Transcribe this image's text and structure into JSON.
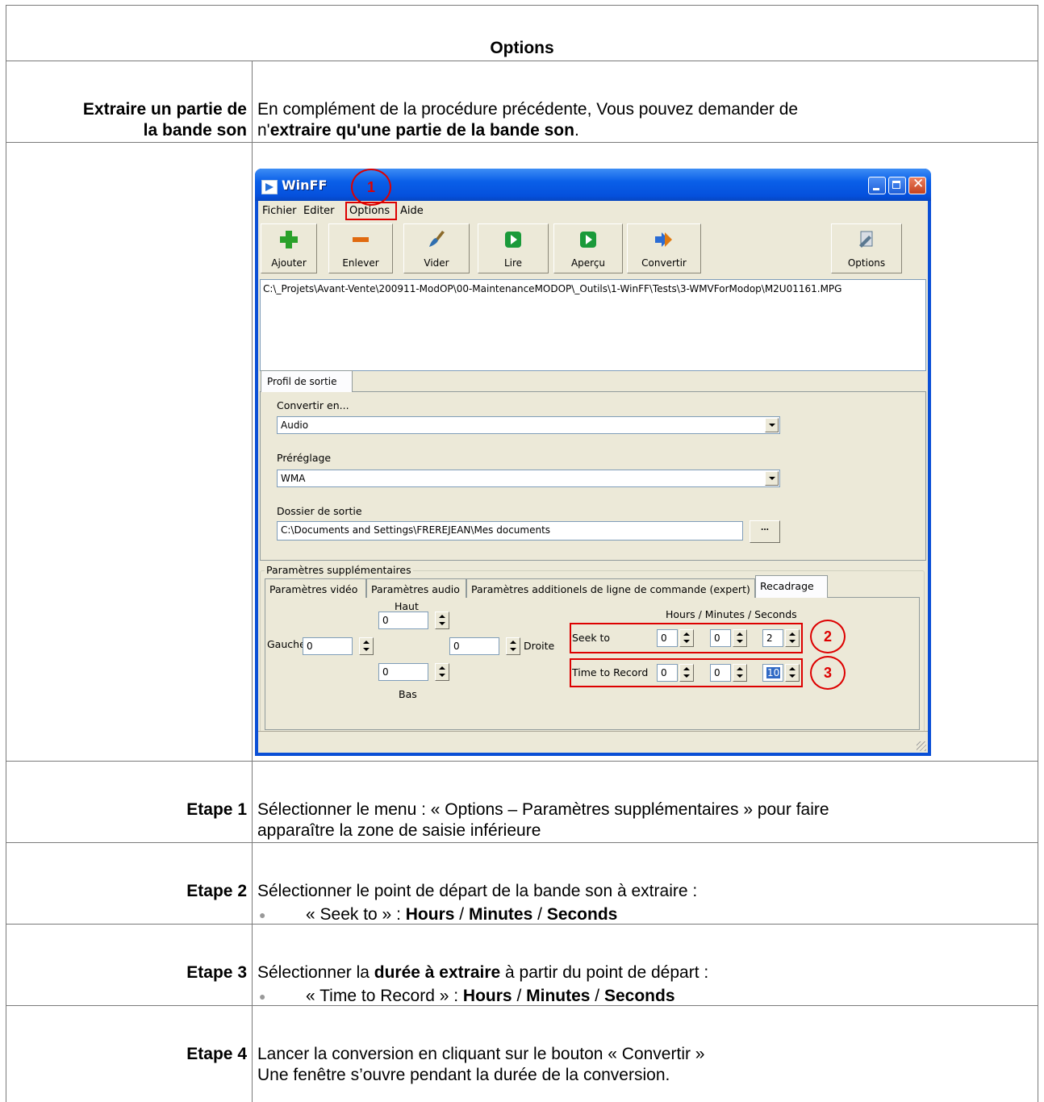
{
  "doc": {
    "title": "Options",
    "section_label_line1": "Extraire un partie de",
    "section_label_line2": "la bande son",
    "section_text_line1": "En complément de la procédure précédente, Vous pouvez demander de",
    "section_text_line2_prefix": "n'",
    "section_text_line2_bold": "extraire qu'une partie de la bande son",
    "section_text_line2_suffix": ".",
    "steps": [
      {
        "label": "Etape 1",
        "line1": "Sélectionner le menu : « Options – Paramètres supplémentaires » pour faire",
        "line2": "apparaître la zone de saisie inférieure"
      },
      {
        "label": "Etape 2",
        "line1": "Sélectionner le point de départ de la bande son à extraire :",
        "bullet_prefix": "« Seek to » : ",
        "b1": "Hours",
        "sep1": " / ",
        "b2": "Minutes",
        "sep2": " / ",
        "b3": "Seconds"
      },
      {
        "label": "Etape 3",
        "line1_prefix": "Sélectionner la ",
        "line1_bold": "durée à extraire",
        "line1_suffix": " à partir du point de départ :",
        "bullet_prefix": "« Time to Record » : ",
        "b1": "Hours",
        "sep1": " / ",
        "b2": "Minutes",
        "sep2": " / ",
        "b3": "Seconds"
      },
      {
        "label": "Etape 4",
        "line1": "Lancer la conversion en cliquant sur le bouton « Convertir »",
        "line2": "Une fenêtre s’ouvre pendant la durée de la conversion."
      }
    ]
  },
  "window": {
    "title": "WinFF",
    "menu": [
      "Fichier",
      "Editer",
      "Options",
      "Aide"
    ],
    "toolbar": [
      {
        "label": "Ajouter",
        "icon": "plus-icon",
        "color": "#2aa12a"
      },
      {
        "label": "Enlever",
        "icon": "minus-icon",
        "color": "#e06a10"
      },
      {
        "label": "Vider",
        "icon": "broom-icon",
        "color": "#2f6fb0"
      },
      {
        "label": "Lire",
        "icon": "play-icon",
        "color": "#1a9a3a"
      },
      {
        "label": "Aperçu",
        "icon": "preview-icon",
        "color": "#1a9a3a"
      },
      {
        "label": "Convertir",
        "icon": "convert-icon",
        "color": "#2b6cd4"
      },
      {
        "label": "Options",
        "icon": "settings-icon",
        "color": "#5a7890"
      }
    ],
    "file_path": "C:\\_Projets\\Avant-Vente\\200911-ModOP\\00-MaintenanceMODOP\\_Outils\\1-WinFF\\Tests\\3-WMVForModop\\M2U01161.MPG",
    "profile_tab": "Profil de sortie",
    "convert_label": "Convertir en...",
    "convert_value": "Audio",
    "preset_label": "Préréglage",
    "preset_value": "WMA",
    "output_label": "Dossier de sortie",
    "output_value": "C:\\Documents and Settings\\FREREJEAN\\Mes documents",
    "browse_label": "...",
    "extra_group": "Paramètres supplémentaires",
    "tabs": [
      "Paramètres vidéo",
      "Paramètres audio",
      "Paramètres additionels de ligne de commande (expert)",
      "Recadrage"
    ],
    "crop": {
      "haut_label": "Haut",
      "bas_label": "Bas",
      "gauche_label": "Gauche",
      "droite_label": "Droite",
      "haut": "0",
      "bas": "0",
      "gauche": "0",
      "droite": "0"
    },
    "time_header": "Hours / Minutes / Seconds",
    "seek_label": "Seek to",
    "seek": [
      "0",
      "0",
      "2"
    ],
    "record_label": "Time to Record",
    "record": [
      "0",
      "0",
      "10"
    ],
    "annotations": [
      "1",
      "2",
      "3"
    ]
  }
}
